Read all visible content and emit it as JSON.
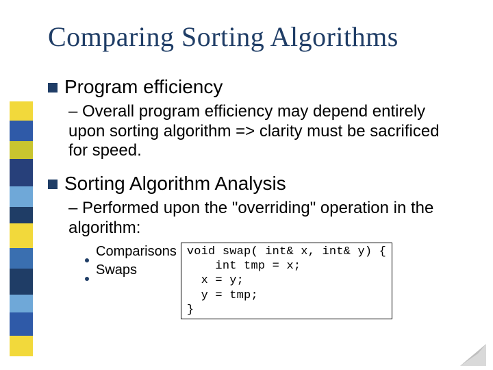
{
  "title": "Comparing Sorting Algorithms",
  "bullets": [
    {
      "label": "Program efficiency",
      "sub": "– Overall program efficiency may depend entirely upon sorting algorithm => clarity must be sacrificed for speed."
    },
    {
      "label": "Sorting Algorithm Analysis",
      "sub": "– Performed upon the \"overriding\" operation in the algorithm:",
      "items": [
        "Comparisons",
        "Swaps"
      ]
    }
  ],
  "code": "void swap( int& x, int& y) {\n    int tmp = x;\n  x = y;\n  y = tmp;\n}",
  "deco_colors": [
    "#f2d93b",
    "#2f5aa8",
    "#c9c52f",
    "#27407a",
    "#6fa8d8",
    "#1f3d66",
    "#f2d93b",
    "#3a6fb0",
    "#1f3d66",
    "#6fa8d8",
    "#2f5aa8",
    "#f2d93b"
  ],
  "deco_heights": [
    28,
    30,
    26,
    40,
    30,
    24,
    36,
    30,
    38,
    26,
    34,
    30
  ]
}
